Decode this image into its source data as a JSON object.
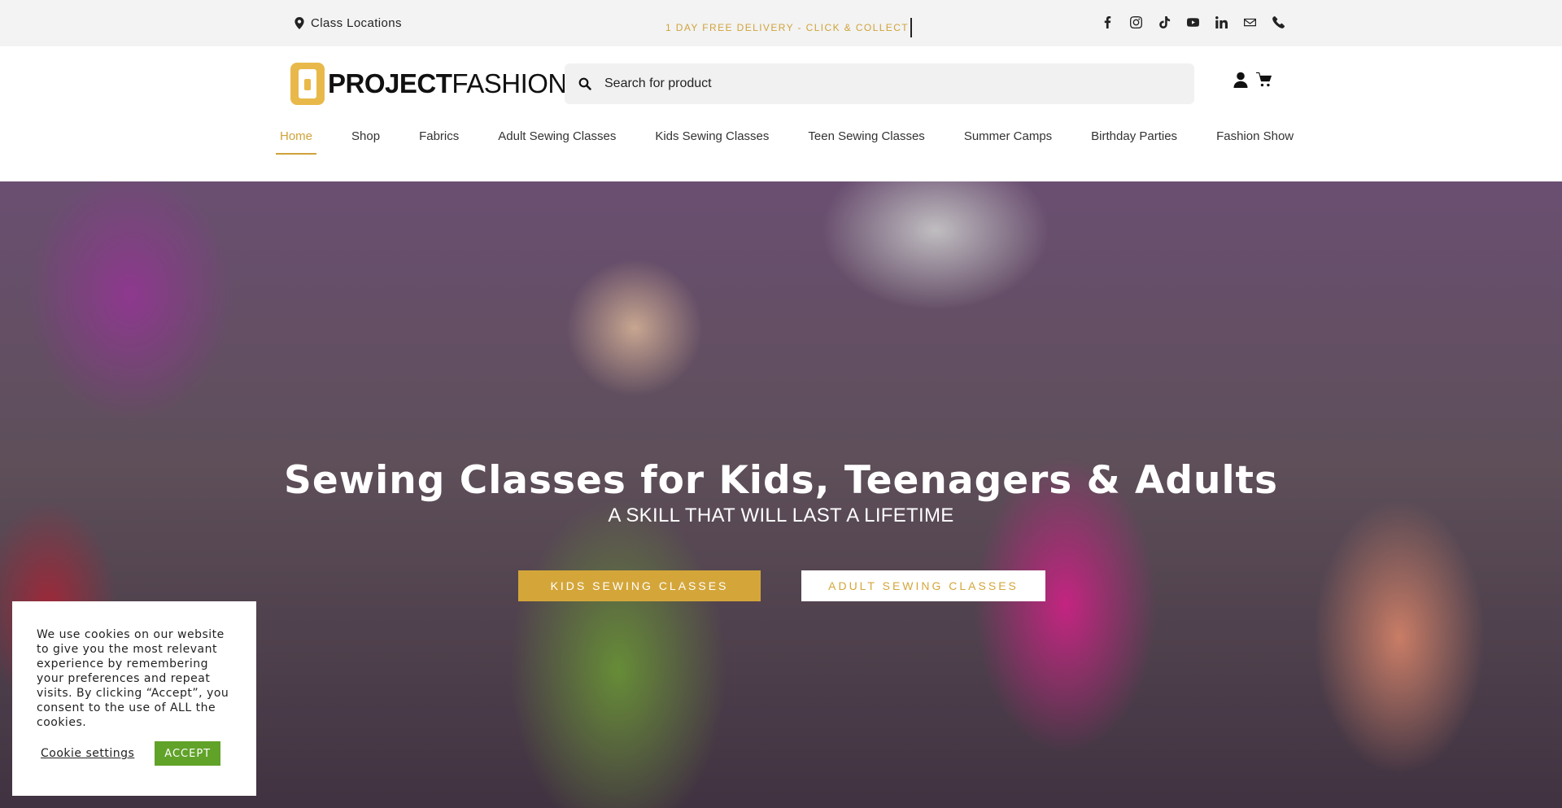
{
  "topbar": {
    "location_label": "Class Locations",
    "promo": "1 DAY FREE DELIVERY - CLICK & COLLECT",
    "social_icons": [
      "facebook-icon",
      "instagram-icon",
      "tiktok-icon",
      "youtube-icon",
      "linkedin-icon",
      "mail-icon",
      "phone-icon"
    ]
  },
  "header": {
    "logo_bold": "PROJECT",
    "logo_light": "FASHION",
    "search_placeholder": "Search for product",
    "icons": [
      "user-icon",
      "cart-icon"
    ]
  },
  "nav": {
    "items": [
      {
        "label": "Home",
        "active": true
      },
      {
        "label": "Shop",
        "active": false
      },
      {
        "label": "Fabrics",
        "active": false
      },
      {
        "label": "Adult Sewing Classes",
        "active": false
      },
      {
        "label": "Kids Sewing Classes",
        "active": false
      },
      {
        "label": "Teen Sewing Classes",
        "active": false
      },
      {
        "label": "Summer Camps",
        "active": false
      },
      {
        "label": "Birthday Parties",
        "active": false
      },
      {
        "label": "Fashion Show",
        "active": false
      }
    ]
  },
  "hero": {
    "title": "Sewing Classes for Kids, Teenagers & Adults",
    "subtitle": "A SKILL THAT WILL LAST A LIFETIME",
    "primary_button": "KIDS SEWING CLASSES",
    "secondary_button": "ADULT SEWING CLASSES"
  },
  "cookie": {
    "message": "We use cookies on our website to give you the most relevant experience by remembering your preferences and repeat visits. By clicking “Accept”, you consent to the use of ALL the cookies.",
    "settings_label": "Cookie settings",
    "accept_label": "ACCEPT"
  },
  "colors": {
    "accent": "#d4a63a",
    "accept_green": "#61a229",
    "topbar_bg": "#f3f3f3"
  }
}
